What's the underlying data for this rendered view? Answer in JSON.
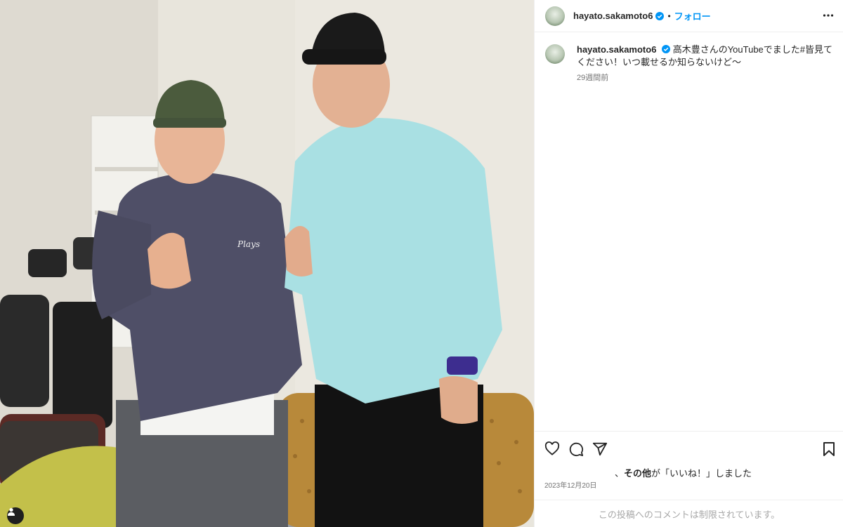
{
  "post": {
    "username": "hayato.sakamoto6",
    "follow_label": "フォロー",
    "separator": "•",
    "caption": "高木豊さんのYouTubeでました#皆見てください！いつ載せるか知らないけど〜",
    "caption_time": "29週間前",
    "likes_prefix": "、",
    "likes_bold": "その他",
    "likes_suffix": "が「いいね！」しました",
    "date": "2023年12月20日",
    "comments_disabled": "この投稿へのコメントは制限されています。"
  },
  "icons": {
    "verified": "verified-badge-icon",
    "more": "more-options-icon",
    "like": "heart-icon",
    "comment": "comment-icon",
    "share": "share-icon",
    "save": "bookmark-icon",
    "tags": "user-tag-icon"
  },
  "colors": {
    "accent": "#0095f6",
    "verified": "#0095f6",
    "muted": "#737373"
  }
}
